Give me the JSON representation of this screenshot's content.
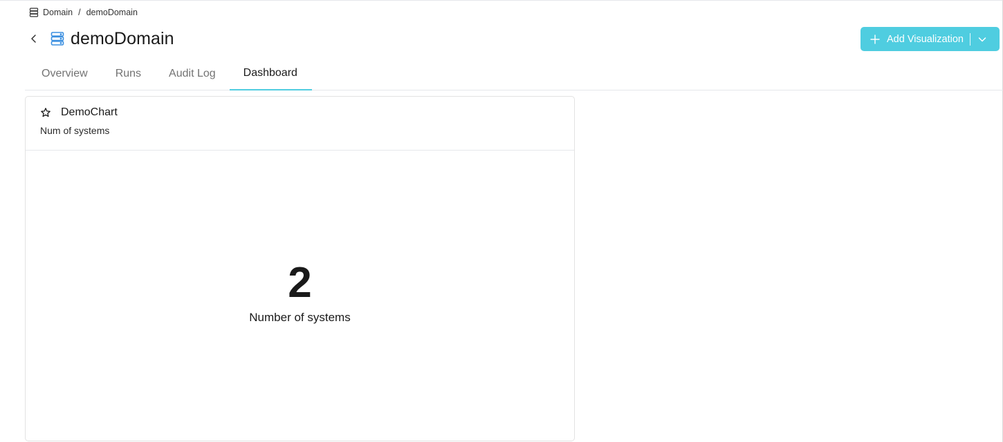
{
  "breadcrumb": {
    "icon": "database-icon",
    "root": "Domain",
    "separator": "/",
    "current": "demoDomain"
  },
  "header": {
    "title": "demoDomain",
    "title_icon": "server-icon",
    "back_icon": "chevron-left-icon"
  },
  "actions": {
    "add_visualization_label": "Add Visualization",
    "add_icon": "plus-icon",
    "dropdown_icon": "chevron-down-icon",
    "accent_color": "#4fcde0"
  },
  "tabs": [
    {
      "label": "Overview",
      "active": false
    },
    {
      "label": "Runs",
      "active": false
    },
    {
      "label": "Audit Log",
      "active": false
    },
    {
      "label": "Dashboard",
      "active": true
    }
  ],
  "card": {
    "favorite_icon": "star-icon",
    "title": "DemoChart",
    "subtitle": "Num of systems",
    "metric_value": "2",
    "metric_label": "Number of systems"
  }
}
